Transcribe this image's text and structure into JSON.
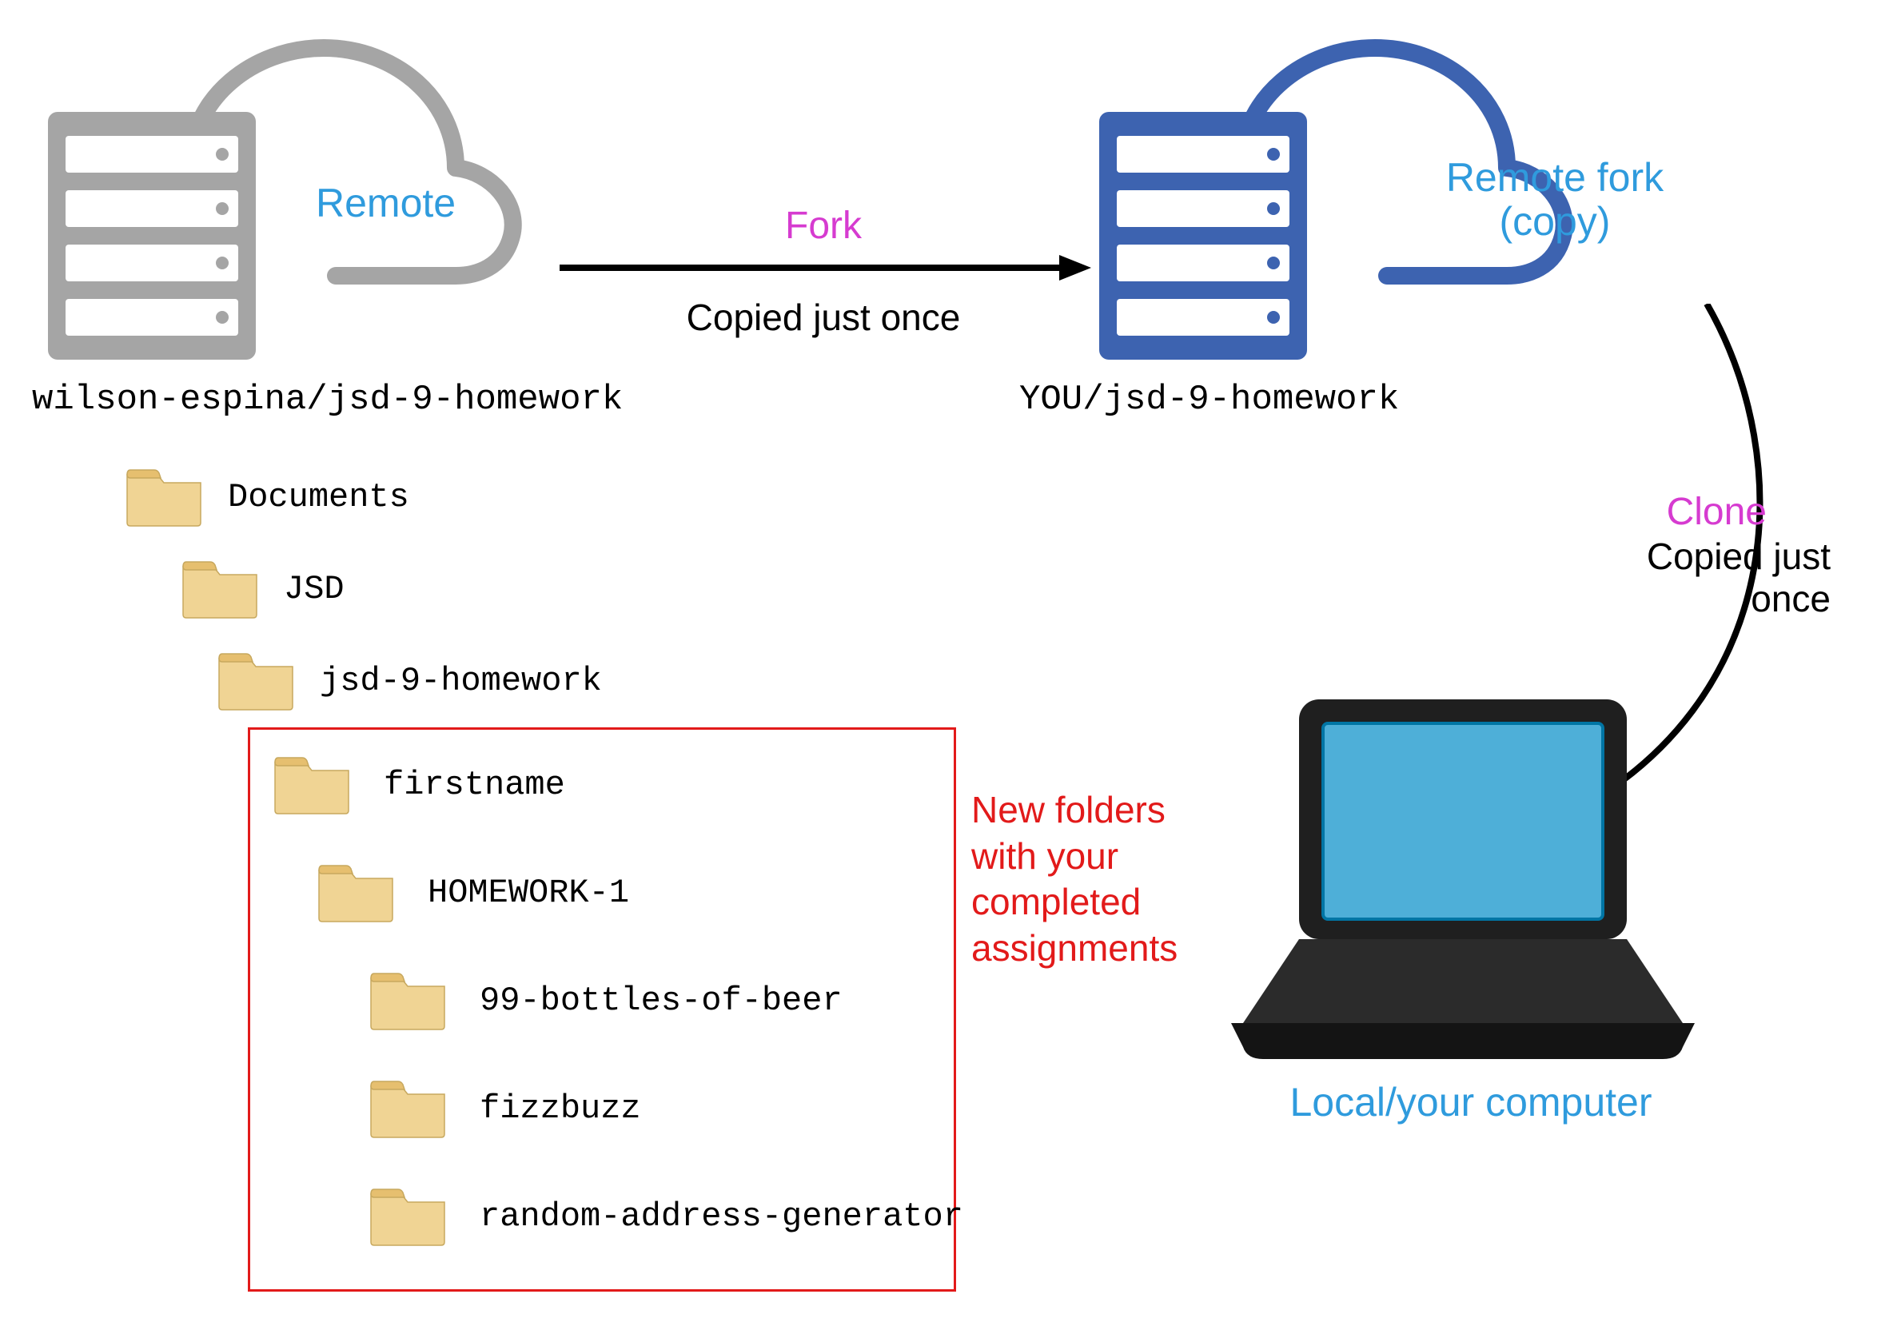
{
  "remote_source": {
    "label": "Remote",
    "caption": "wilson-espina/jsd-9-homework"
  },
  "remote_fork": {
    "label_line1": "Remote fork",
    "label_line2": "(copy)",
    "caption": "YOU/jsd-9-homework"
  },
  "fork_arrow": {
    "title": "Fork",
    "subtitle": "Copied just once"
  },
  "clone_arrow": {
    "title": "Clone",
    "subtitle_line1": "Copied just",
    "subtitle_line2": "once"
  },
  "local": {
    "caption": "Local/your computer"
  },
  "folders": {
    "level0": "Documents",
    "level1": "JSD",
    "level2": "jsd-9-homework",
    "level3": "firstname",
    "level4": "HOMEWORK-1",
    "level5a": "99-bottles-of-beer",
    "level5b": "fizzbuzz",
    "level5c": "random-address-generator"
  },
  "annotation": {
    "line1": "New folders",
    "line2": "with your",
    "line3": "completed",
    "line4": "assignments"
  },
  "colors": {
    "gray": "#a5a5a5",
    "blue_server": "#3d63b0",
    "blue_text": "#2f9bdd",
    "magenta": "#d63bd0",
    "red": "#e21a1a",
    "folder_body": "#f0d494",
    "folder_tab": "#e6bf6f",
    "laptop_screen": "#4eafd8"
  }
}
